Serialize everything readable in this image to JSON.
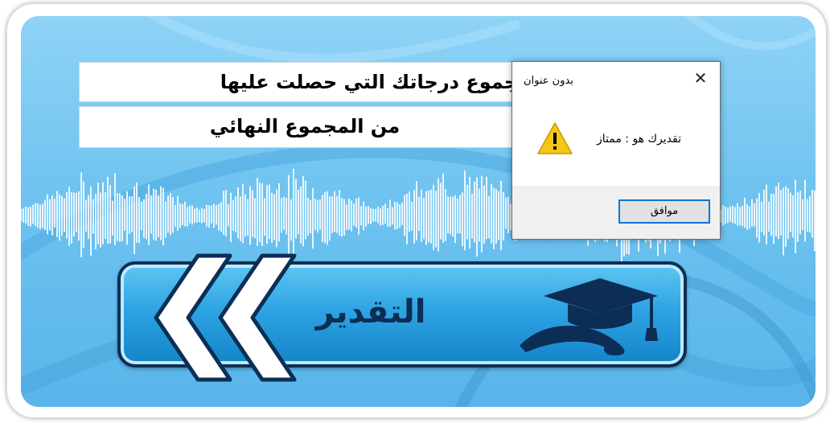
{
  "form": {
    "line1": "مجموع درجاتك التي حصلت عليها",
    "line2": "من المجموع النهائي"
  },
  "grade_button": {
    "label": "التقدير",
    "icon": "graduation-cap-diploma-icon",
    "arrows_icon": "double-chevron-left-icon"
  },
  "dialog": {
    "title": "بدون عنوان",
    "message": "تقديرك هو : ممتاز",
    "icon": "warning-icon",
    "ok_label": "موافق",
    "close_symbol": "✕"
  },
  "colors": {
    "background": "#6fc3f0",
    "button": "#2ea4e3",
    "button_border": "#0b2f55",
    "dialog_accent": "#0078d7",
    "warning": "#f5c518"
  }
}
